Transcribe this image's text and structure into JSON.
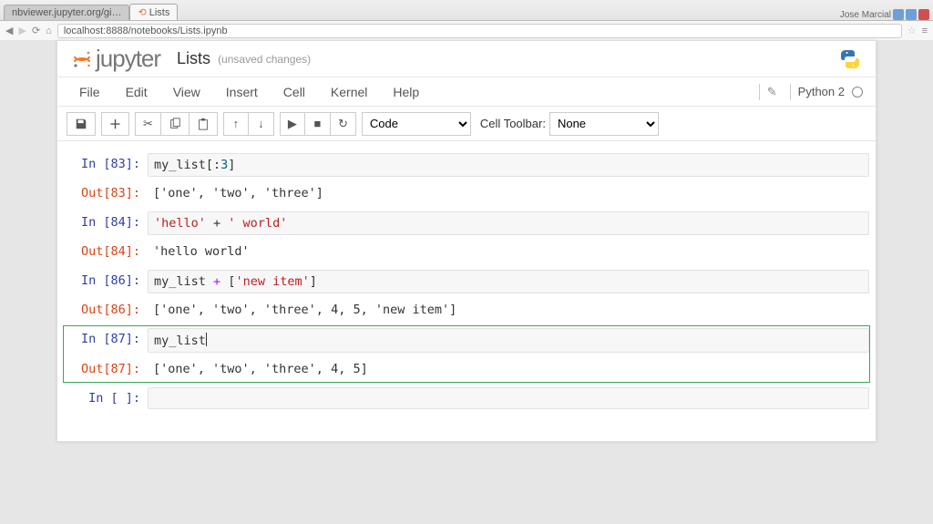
{
  "browser": {
    "tab1": "nbviewer.jupyter.org/gi…",
    "tab2": "Lists",
    "url": "localhost:8888/notebooks/Lists.ipynb"
  },
  "header": {
    "brand": "jupyter",
    "notebook_title": "Lists",
    "status": "(unsaved changes)"
  },
  "menubar": {
    "items": [
      "File",
      "Edit",
      "View",
      "Insert",
      "Cell",
      "Kernel",
      "Help"
    ],
    "kernel_name": "Python 2"
  },
  "toolbar": {
    "cell_type": "Code",
    "cell_toolbar_label": "Cell Toolbar:",
    "cell_toolbar_value": "None"
  },
  "cells": [
    {
      "in_label": "In [83]:",
      "out_label": "Out[83]:",
      "code_html": "my_list[:<span class='kw-num'>3</span>]",
      "output": "['one', 'two', 'three']"
    },
    {
      "in_label": "In [84]:",
      "out_label": "Out[84]:",
      "code_html": "<span class='kw-str'>'hello'</span> + <span class='kw-str'>' world'</span>",
      "output": "'hello world'"
    },
    {
      "in_label": "In [86]:",
      "out_label": "Out[86]:",
      "code_html": "my_list <span class='kw-op'>+</span> [<span class='kw-str'>'new item'</span>]",
      "output": "['one', 'two', 'three', 4, 5, 'new item']"
    },
    {
      "in_label": "In [87]:",
      "out_label": "Out[87]:",
      "code_html": "my_list<span class='cursor'></span>",
      "output": "['one', 'two', 'three', 4, 5]",
      "selected": true
    },
    {
      "in_label": "In [ ]:",
      "out_label": "",
      "code_html": "",
      "output": ""
    }
  ]
}
